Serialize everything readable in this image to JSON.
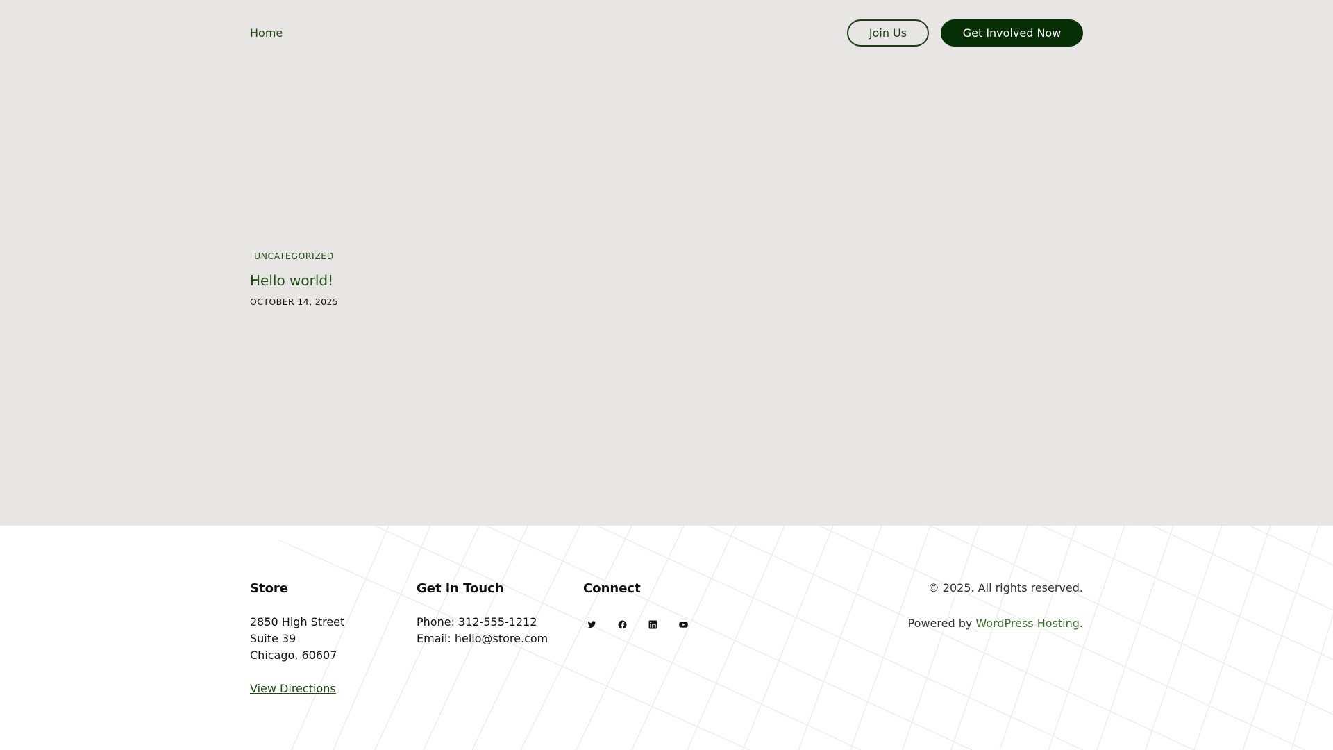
{
  "header": {
    "nav_home": "Home",
    "join_label": "Join Us",
    "involved_label": "Get Involved Now"
  },
  "post": {
    "category": "UNCATEGORIZED",
    "title": "Hello world!",
    "date": "OCTOBER 14, 2025"
  },
  "footer": {
    "store": {
      "heading": "Store",
      "line1": "2850 High Street",
      "line2": "Suite 39",
      "line3": "Chicago, 60607",
      "directions": "View Directions"
    },
    "touch": {
      "heading": "Get in Touch",
      "phone": "Phone: 312-555-1212",
      "email": "Email: hello@store.com"
    },
    "connect": {
      "heading": "Connect",
      "icons": [
        "twitter-icon",
        "facebook-icon",
        "linkedin-icon",
        "youtube-icon"
      ]
    },
    "copyright": "© 2025. All rights reserved.",
    "powered_prefix": "Powered by ",
    "powered_link": "WordPress Hosting",
    "powered_suffix": "."
  },
  "colors": {
    "main_background": "#e7e6e5",
    "accent_green": "#1c4a0f",
    "button_dark": "#062f05"
  }
}
